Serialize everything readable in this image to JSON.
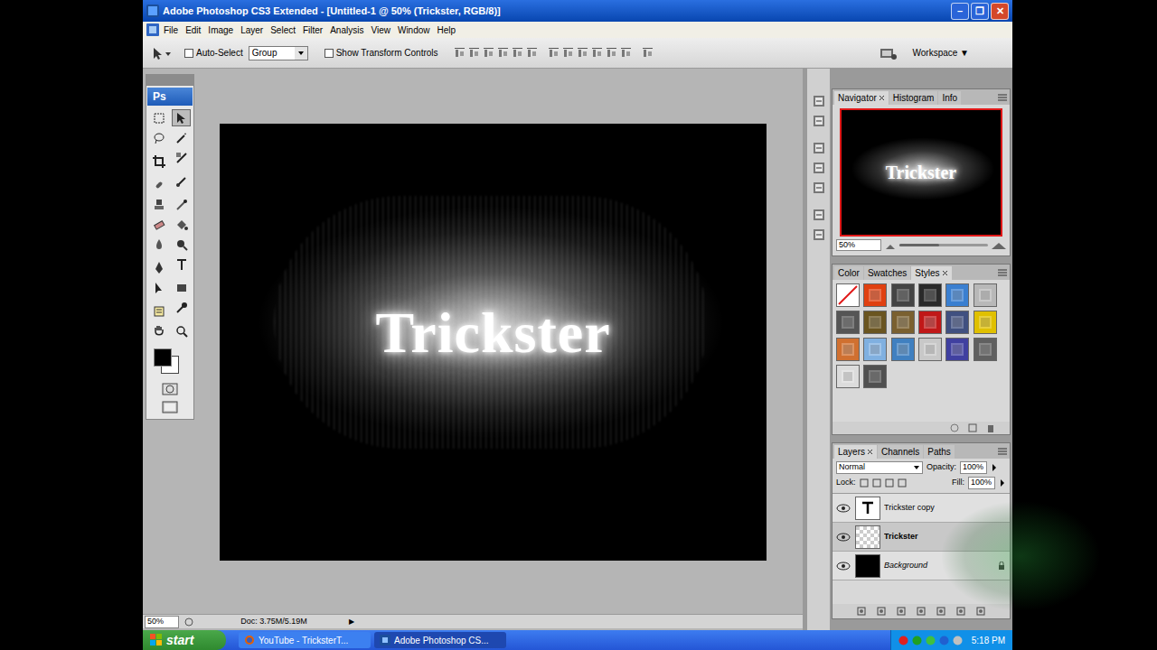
{
  "window": {
    "title": "Adobe Photoshop CS3 Extended - [Untitled-1 @ 50% (Trickster, RGB/8)]",
    "controls": [
      "–",
      "❐",
      "✕"
    ]
  },
  "menu": [
    "File",
    "Edit",
    "Image",
    "Layer",
    "Select",
    "Filter",
    "Analysis",
    "View",
    "Window",
    "Help"
  ],
  "options": {
    "auto_select": {
      "label": "Auto-Select",
      "checked": false
    },
    "dropdown": "Group",
    "show_transform": {
      "label": "Show Transform Controls",
      "checked": false
    },
    "workspace": "Workspace ▼"
  },
  "toolbox": {
    "logo": "Ps",
    "tools": [
      {
        "selected": false
      },
      {
        "selected": true
      },
      {
        "selected": false
      },
      {
        "selected": false
      },
      {
        "selected": false
      },
      {
        "selected": false
      },
      {
        "selected": false
      },
      {
        "selected": false
      },
      {
        "selected": false
      },
      {
        "selected": false
      },
      {
        "selected": false
      },
      {
        "selected": false
      },
      {
        "selected": false
      },
      {
        "selected": false
      },
      {
        "selected": false
      },
      {
        "selected": false
      },
      {
        "selected": false
      },
      {
        "selected": false
      },
      {
        "selected": false
      },
      {
        "selected": false
      },
      {
        "selected": false
      },
      {
        "selected": false
      }
    ]
  },
  "canvas": {
    "text": "Trickster"
  },
  "navigator": {
    "tabs": [
      {
        "label": "Navigator",
        "selected": true
      },
      {
        "label": "Histogram",
        "selected": false
      },
      {
        "label": "Info",
        "selected": false
      }
    ],
    "zoom": "50%",
    "level": 0.45
  },
  "styles_panel": {
    "tabs": [
      {
        "label": "Color",
        "selected": false
      },
      {
        "label": "Swatches",
        "selected": false
      },
      {
        "label": "Styles",
        "selected": true
      }
    ],
    "styles": [
      {
        "kind": "none",
        "color": "#ffffff"
      },
      {
        "kind": "style",
        "color": "#e04010"
      },
      {
        "kind": "style",
        "color": "#444444"
      },
      {
        "kind": "style",
        "color": "#2a2a2a"
      },
      {
        "kind": "style",
        "color": "#3a7fd0"
      },
      {
        "kind": "style",
        "color": "#b8b8b8"
      },
      {
        "kind": "style",
        "color": "#555555"
      },
      {
        "kind": "style",
        "color": "#6a5520"
      },
      {
        "kind": "style",
        "color": "#7a6030"
      },
      {
        "kind": "style",
        "color": "#c01818"
      },
      {
        "kind": "style",
        "color": "#405080"
      },
      {
        "kind": "style",
        "color": "#e0c000"
      },
      {
        "kind": "style",
        "color": "#d07030"
      },
      {
        "kind": "style",
        "color": "#80b0e0"
      },
      {
        "kind": "style",
        "color": "#4080c0"
      },
      {
        "kind": "style",
        "color": "#c8c8c8"
      },
      {
        "kind": "style",
        "color": "#4040a0"
      },
      {
        "kind": "style",
        "color": "#606060"
      },
      {
        "kind": "style",
        "color": "#dcdcdc"
      },
      {
        "kind": "style",
        "color": "#505050"
      }
    ]
  },
  "layers_panel": {
    "tabs": [
      {
        "label": "Layers",
        "selected": true
      },
      {
        "label": "Channels",
        "selected": false
      },
      {
        "label": "Paths",
        "selected": false
      }
    ],
    "blend": "Normal",
    "opacity_label": "Opacity:",
    "opacity": "100%",
    "lock_label": "Lock:",
    "fill_label": "Fill:",
    "fill": "100%",
    "layers": [
      {
        "name": "Trickster copy",
        "kind": "text",
        "selected": false,
        "locked": false,
        "visible": true
      },
      {
        "name": "Trickster",
        "kind": "raster",
        "selected": true,
        "locked": false,
        "visible": true
      },
      {
        "name": "Background",
        "kind": "fill",
        "selected": false,
        "locked": true,
        "visible": true
      }
    ]
  },
  "status_bar": {
    "zoom": "50%",
    "doc": "Doc: 3.75M/5.19M",
    "arrow": "▶"
  },
  "taskbar": {
    "start": "start",
    "items": [
      {
        "label": "YouTube - TricksterT...",
        "selected": false
      },
      {
        "label": "Adobe Photoshop CS...",
        "selected": true
      }
    ],
    "time": "5:18 PM"
  }
}
